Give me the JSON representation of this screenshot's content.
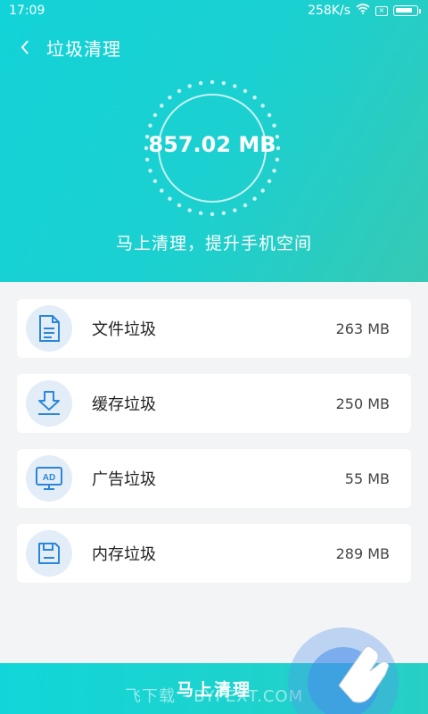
{
  "status_bar": {
    "time": "17:09",
    "speed": "258K/s",
    "icons": [
      "wifi-icon",
      "sim-off-icon",
      "battery-icon"
    ]
  },
  "header": {
    "title": "垃圾清理",
    "back_icon": "chevron-left-icon",
    "total_size": "857.02 MB",
    "subtitle": "马上清理，提升手机空间"
  },
  "items": [
    {
      "label": "文件垃圾",
      "size": "263 MB",
      "icon": "document-icon"
    },
    {
      "label": "缓存垃圾",
      "size": "250 MB",
      "icon": "download-icon"
    },
    {
      "label": "广告垃圾",
      "size": "55 MB",
      "icon": "ad-monitor-icon"
    },
    {
      "label": "内存垃圾",
      "size": "289 MB",
      "icon": "memory-card-icon"
    }
  ],
  "footer": {
    "clean_button": "马上清理",
    "watermark": "飞下载 · BYFEXT.COM"
  },
  "colors": {
    "header_start": "#12d3d8",
    "header_end": "#36c9b4",
    "icon_blue": "#2b86d9",
    "icon_bg": "#e3edf8"
  }
}
